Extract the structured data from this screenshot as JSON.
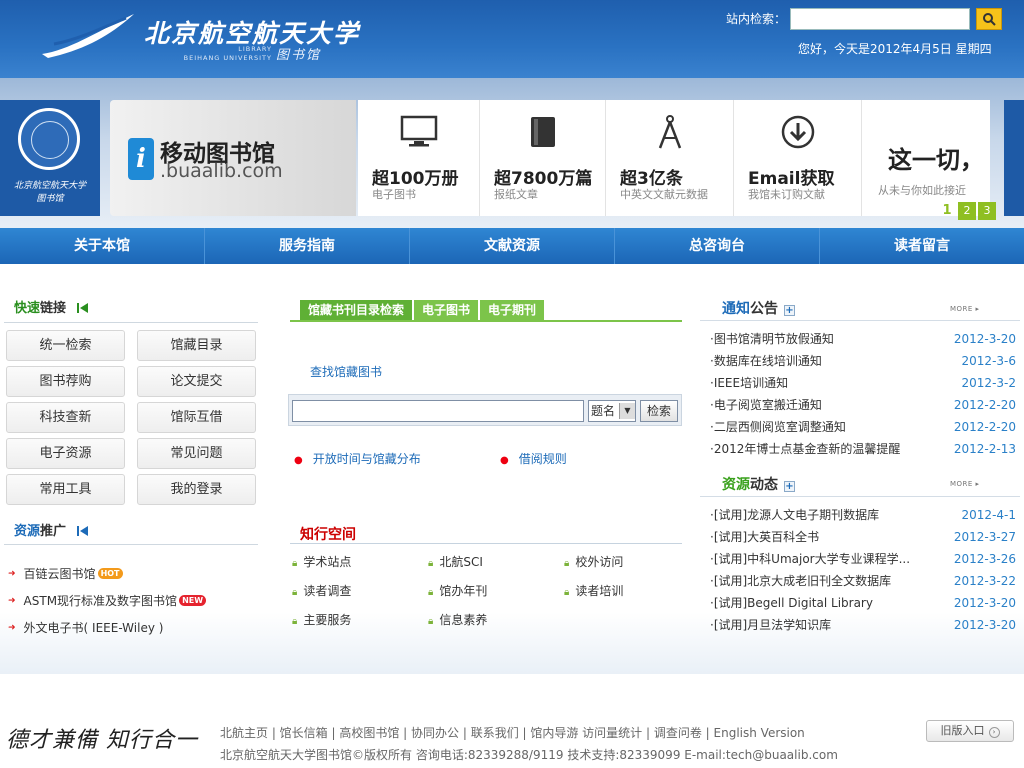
{
  "header": {
    "title": "北京航空航天大学",
    "sub_line1": "LIBRARY",
    "sub_line2": "BEIHANG UNIVERSITY",
    "lib_name": "图书馆",
    "search_label": "站内检索：",
    "search_value": "",
    "greeting": "您好，今天是2012年4月5日 星期四"
  },
  "banner": {
    "badge_text": "北京航空航天大学",
    "badge_sub": "图书馆",
    "mobile_title": "移动图书馆",
    "mobile_url": ".buaalib.com",
    "stats": [
      {
        "big": "超100万册",
        "small": "电子图书",
        "icon": "monitor-icon"
      },
      {
        "big": "超7800万篇",
        "small": "报纸文章",
        "icon": "book-icon"
      },
      {
        "big": "超3亿条",
        "small": "中英文文献元数据",
        "icon": "compass-icon"
      },
      {
        "big": "Email获取",
        "small": "我馆未订购文献",
        "icon": "download-icon"
      }
    ],
    "last_big": "这一切，",
    "last_small": "从未与你如此接近",
    "pager": [
      "1",
      "2",
      "3"
    ]
  },
  "nav": [
    "关于本馆",
    "服务指南",
    "文献资源",
    "总咨询台",
    "读者留言"
  ],
  "quick": {
    "title_hl": "快速",
    "title_rest": "链接",
    "items": [
      "统一检索",
      "馆藏目录",
      "图书荐购",
      "论文提交",
      "科技查新",
      "馆际互借",
      "电子资源",
      "常见问题",
      "常用工具",
      "我的登录"
    ]
  },
  "promo": {
    "title_hl": "资源",
    "title_rest": "推广",
    "items": [
      {
        "label": "百链云图书馆",
        "tag": "HOT"
      },
      {
        "label": "ASTM现行标准及数字图书馆",
        "tag": "NEW"
      },
      {
        "label": "外文电子书( IEEE-Wiley )",
        "tag": ""
      }
    ]
  },
  "catalog": {
    "tabs": [
      "馆藏书刊目录检索",
      "电子图书",
      "电子期刊"
    ],
    "find_link": "查找馆藏图书",
    "select_value": "题名",
    "search_btn": "检索",
    "links": [
      "开放时间与馆藏分布",
      "借阅规则"
    ]
  },
  "zhixing": {
    "title": "知行空间",
    "items": [
      "学术站点",
      "北航SCI",
      "校外访问",
      "读者调查",
      "馆办年刊",
      "读者培训",
      "主要服务",
      "信息素养"
    ]
  },
  "notice": {
    "title_hl": "通知",
    "title_rest": "公告",
    "more": "MORE ▸",
    "rows": [
      {
        "t": "·图书馆清明节放假通知",
        "d": "2012-3-20"
      },
      {
        "t": "·数据库在线培训通知",
        "d": "2012-3-6"
      },
      {
        "t": "·IEEE培训通知",
        "d": "2012-3-2"
      },
      {
        "t": "·电子阅览室搬迁通知",
        "d": "2012-2-20"
      },
      {
        "t": "·二层西侧阅览室调整通知",
        "d": "2012-2-20"
      },
      {
        "t": "·2012年博士点基金查新的温馨提醒",
        "d": "2012-2-13"
      }
    ]
  },
  "resource": {
    "title_hl": "资源",
    "title_rest": "动态",
    "more": "MORE ▸",
    "rows": [
      {
        "t": "·[试用]龙源人文电子期刊数据库",
        "d": "2012-4-1"
      },
      {
        "t": "·[试用]大英百科全书",
        "d": "2012-3-27"
      },
      {
        "t": "·[试用]中科Umajor大学专业课程学...",
        "d": "2012-3-26"
      },
      {
        "t": "·[试用]北京大成老旧刊全文数据库",
        "d": "2012-3-22"
      },
      {
        "t": "·[试用]Begell Digital Library",
        "d": "2012-3-20"
      },
      {
        "t": "·[试用]月旦法学知识库",
        "d": "2012-3-20"
      }
    ]
  },
  "footer": {
    "motto": "德才兼備 知行合一",
    "links": "北航主页 | 馆长信箱 | 高校图书馆 | 协同办公 | 联系我们 | 馆内导游 访问量统计 | 调查问卷 | English Version",
    "copy": "北京航空航天大学图书馆©版权所有 咨询电话:82339288/9119 技术支持:82339099 E-mail:tech@buaalib.com",
    "old_btn": "旧版入口"
  },
  "colors": {
    "brand_blue": "#1f5fae",
    "accent_green": "#7cc44a",
    "date_blue": "#2a80c8",
    "title_red": "#c00"
  }
}
